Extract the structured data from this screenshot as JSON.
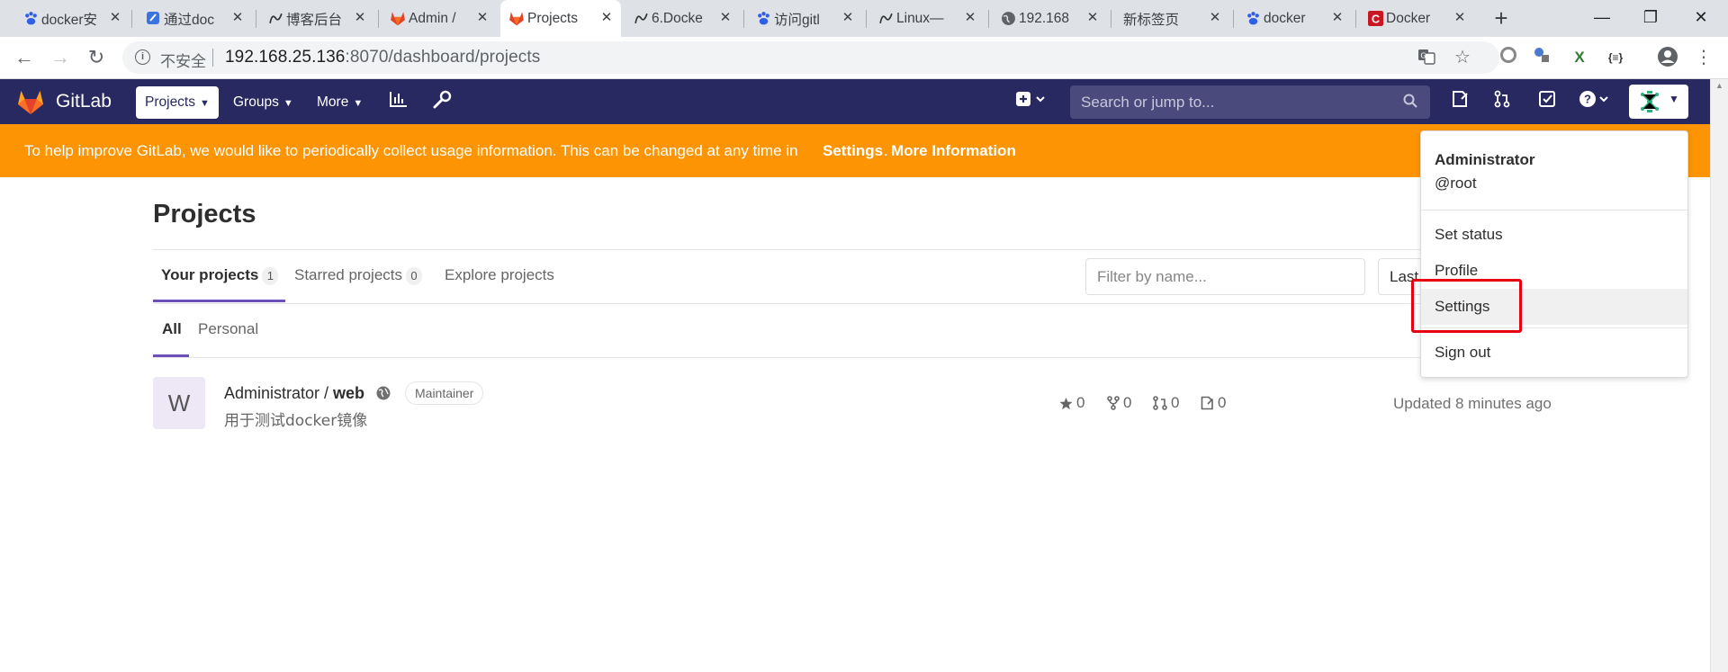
{
  "browser": {
    "tabs": [
      {
        "title": "docker安",
        "favicon": "baidu-paw-icon"
      },
      {
        "title": "通过doc",
        "favicon": "notebook-icon"
      },
      {
        "title": "博客后台",
        "favicon": "cnblogs-icon"
      },
      {
        "title": "Admin /",
        "favicon": "gitlab-icon"
      },
      {
        "title": "Projects",
        "favicon": "gitlab-icon"
      },
      {
        "title": "6.Docke",
        "favicon": "cnblogs-icon"
      },
      {
        "title": "访问gitl",
        "favicon": "baidu-paw-icon"
      },
      {
        "title": "Linux—",
        "favicon": "cnblogs-icon"
      },
      {
        "title": "192.168",
        "favicon": "globe-icon"
      },
      {
        "title": "新标签页",
        "favicon": ""
      },
      {
        "title": "docker",
        "favicon": "baidu-paw-icon"
      },
      {
        "title": "Docker",
        "favicon": "csdn-icon"
      }
    ],
    "active_tab": 4,
    "new_tab": "+",
    "security_label": "不安全",
    "url_host": "192.168.25.136",
    "url_rest": ":8070/dashboard/projects"
  },
  "gitlab": {
    "brand": "GitLab",
    "nav": {
      "projects": "Projects",
      "groups": "Groups",
      "more": "More"
    },
    "search_placeholder": "Search or jump to...",
    "banner": {
      "text": "To help improve GitLab, we would like to periodically collect usage information. This can be changed at any time in",
      "settings_link": "Settings",
      "period": ".",
      "more_link": "More Information"
    }
  },
  "page": {
    "title": "Projects",
    "tabs": [
      {
        "label": "Your projects",
        "count": "1"
      },
      {
        "label": "Starred projects",
        "count": "0"
      },
      {
        "label": "Explore projects"
      }
    ],
    "subtabs": [
      "All",
      "Personal"
    ],
    "filter_placeholder": "Filter by name...",
    "sort_label": "Last"
  },
  "project": {
    "avatar_letter": "W",
    "namespace": "Administrator / ",
    "name": "web",
    "role": "Maintainer",
    "description": "用于测试docker镜像",
    "stars": "0",
    "forks": "0",
    "merge_requests": "0",
    "issues": "0",
    "updated": "Updated 8 minutes ago"
  },
  "user_menu": {
    "name": "Administrator",
    "username": "@root",
    "items": [
      "Set status",
      "Profile",
      "Settings",
      "Sign out"
    ]
  },
  "colors": {
    "header": "#292961",
    "banner": "#fc9403",
    "highlight": "#e60012",
    "tab_underline": "#6b4fbb"
  }
}
